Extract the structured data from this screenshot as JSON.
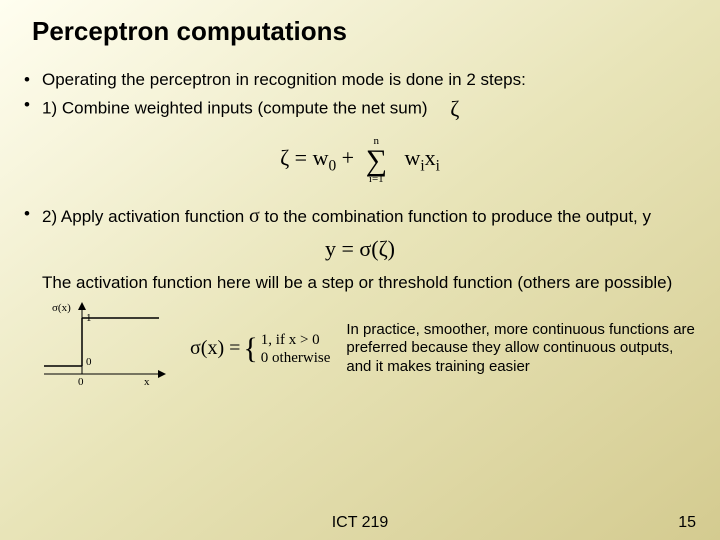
{
  "title": "Perceptron computations",
  "bullets": {
    "b1": "Operating the perceptron in recognition mode is done in 2 steps:",
    "b2_pre": "1) Combine weighted inputs (compute the net sum)",
    "b2_sym": "ζ",
    "b3_pre": "2) Apply activation function ",
    "b3_sym": "σ",
    "b3_post": " to the combination function to produce the output, y"
  },
  "formula1": {
    "lhs": "ζ =  w",
    "lhs_sub": "0",
    "plus": " + ",
    "sum_top": "n",
    "sum_sig": "∑",
    "sum_bot": "i=1",
    "rhs_w": "w",
    "rhs_wsub": "i",
    "rhs_x": "x",
    "rhs_xsub": "i"
  },
  "formula2": "y = σ(ζ)",
  "activation_text": "The activation function here will be a step or threshold function (others are possible)",
  "graph": {
    "ylabel": "σ(x)",
    "one": "1",
    "zero_y": "0",
    "zero_x": "0",
    "xlabel": "x"
  },
  "formula3": {
    "lhs": "σ(x) = ",
    "case1": "1, if x > 0",
    "case2": "0 otherwise"
  },
  "practice_note": "In practice, smoother, more continuous functions are preferred because they allow continuous outputs, and it makes training easier",
  "footer": "ICT 219",
  "page": "15"
}
